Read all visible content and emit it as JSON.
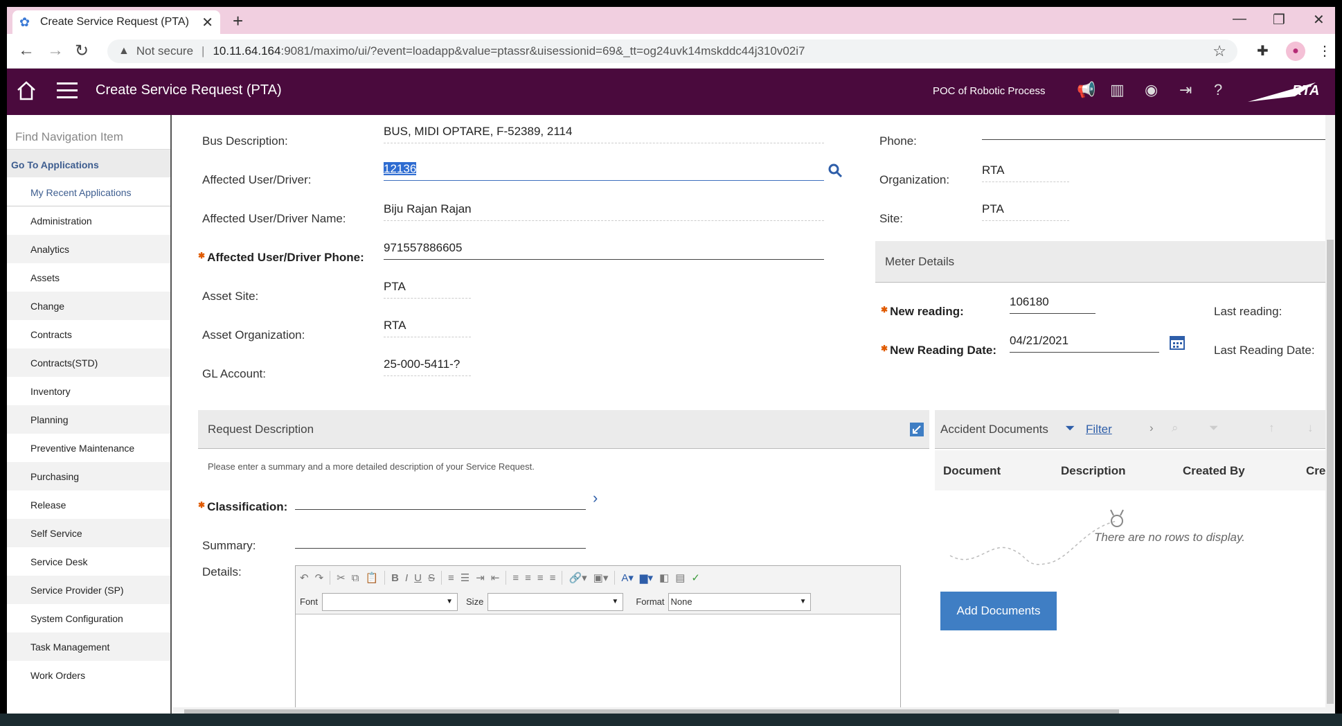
{
  "browser": {
    "tab_title": "Create Service Request (PTA)",
    "url_security": "Not secure",
    "url_host": "10.11.64.164",
    "url_path": ":9081/maximo/ui/?event=loadapp&value=ptassr&uisessionid=69&_tt=og24uvk14mskddc44j310v02i7"
  },
  "header": {
    "app_title": "Create Service Request (PTA)",
    "context": "POC of Robotic Process",
    "logo_text": "RTA"
  },
  "sidebar": {
    "search_placeholder": "Find Navigation Item",
    "goto": "Go To Applications",
    "recent": "My Recent Applications",
    "items": [
      "Administration",
      "Analytics",
      "Assets",
      "Change",
      "Contracts",
      "Contracts(STD)",
      "Inventory",
      "Planning",
      "Preventive Maintenance",
      "Purchasing",
      "Release",
      "Self Service",
      "Service Desk",
      "Service Provider (SP)",
      "System Configuration",
      "Task Management",
      "Work Orders"
    ]
  },
  "form": {
    "bus_description_label": "Bus Description:",
    "bus_description": "BUS, MIDI OPTARE, F-52389, 2114",
    "affected_user_label": "Affected User/Driver:",
    "affected_user": "12136",
    "affected_user_name_label": "Affected User/Driver Name:",
    "affected_user_name": "Biju Rajan Rajan",
    "affected_user_phone_label": "Affected User/Driver Phone:",
    "affected_user_phone": "971557886605",
    "asset_site_label": "Asset Site:",
    "asset_site": "PTA",
    "asset_org_label": "Asset Organization:",
    "asset_org": "RTA",
    "gl_account_label": "GL Account:",
    "gl_account": "25-000-5411-?",
    "phone_label": "Phone:",
    "organization_label": "Organization:",
    "organization": "RTA",
    "site_label": "Site:",
    "site": "PTA"
  },
  "meter": {
    "header": "Meter Details",
    "new_reading_label": "New reading:",
    "new_reading": "106180",
    "new_reading_date_label": "New Reading Date:",
    "new_reading_date": "04/21/2021",
    "last_reading_label": "Last reading:",
    "last_reading_date_label": "Last Reading Date:"
  },
  "request": {
    "header": "Request Description",
    "hint": "Please enter a summary and a more detailed description of your Service Request.",
    "classification_label": "Classification:",
    "summary_label": "Summary:",
    "details_label": "Details:",
    "font_label": "Font",
    "size_label": "Size",
    "format_label": "Format",
    "format_value": "None"
  },
  "documents": {
    "header": "Accident Documents",
    "filter": "Filter",
    "columns": [
      "Document",
      "Description",
      "Created By",
      "Creat"
    ],
    "empty": "There are no rows to display.",
    "add_button": "Add Documents"
  }
}
